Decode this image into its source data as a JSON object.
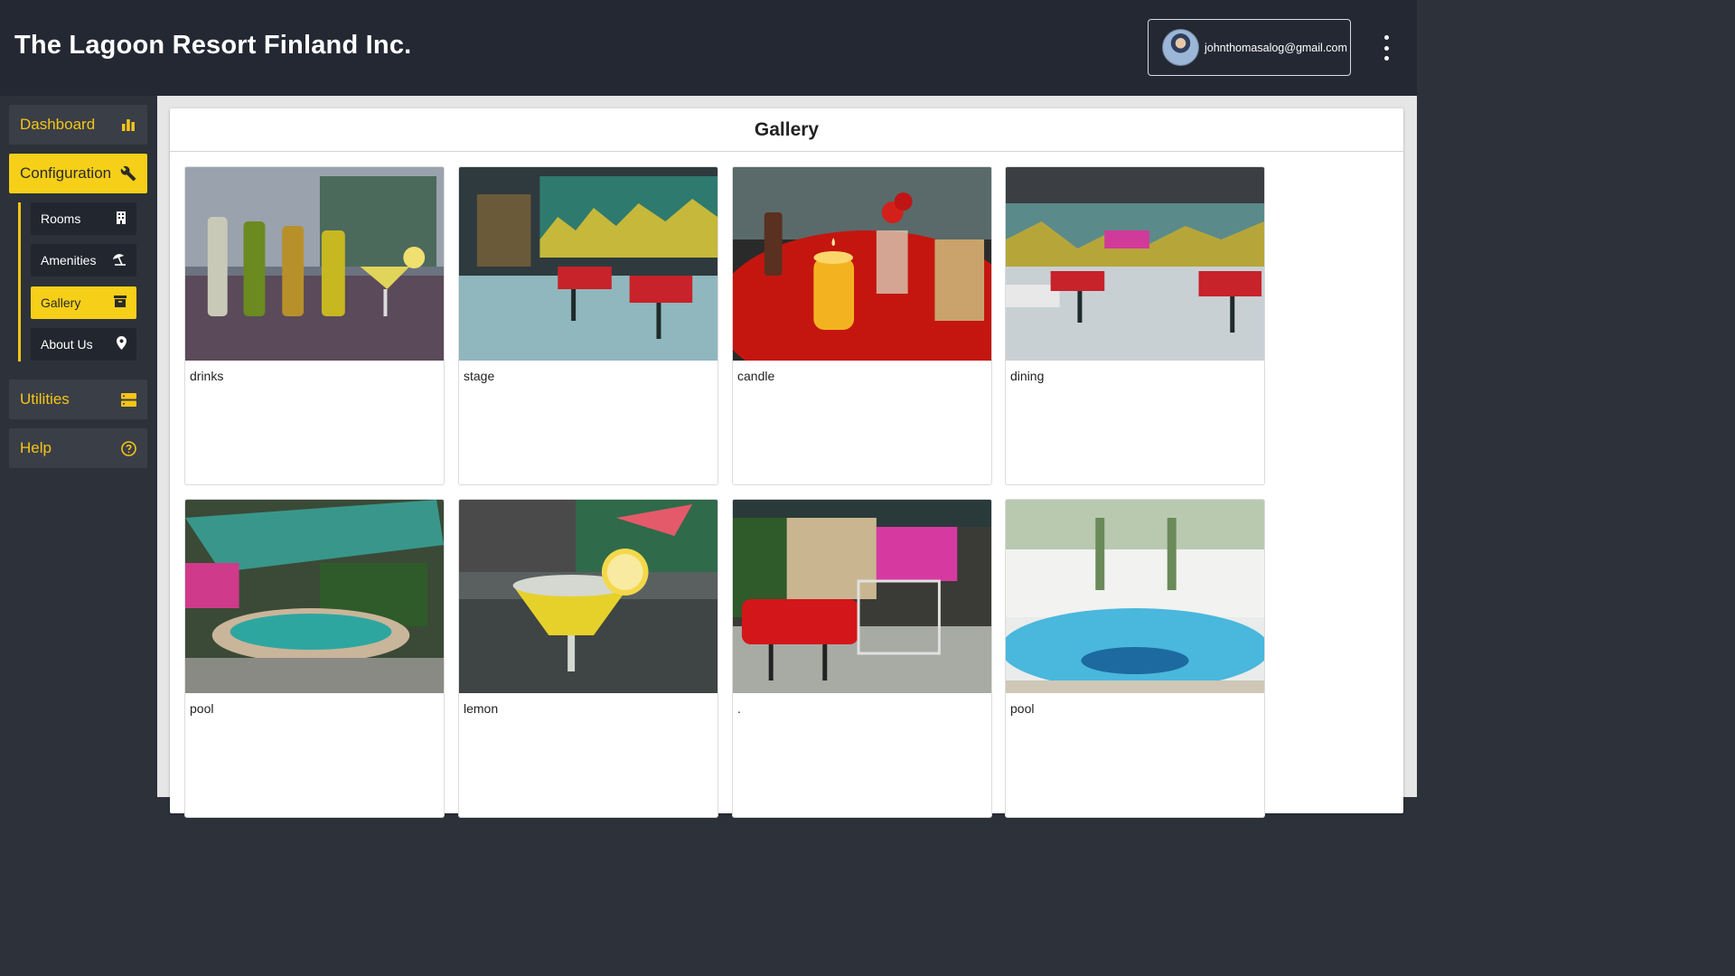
{
  "header": {
    "title": "The Lagoon Resort Finland Inc.",
    "user_email": "johnthomasalog@gmail.com"
  },
  "sidebar": {
    "items": [
      {
        "label": "Dashboard",
        "icon": "bar-chart-icon"
      },
      {
        "label": "Configuration",
        "icon": "wrench-icon",
        "active": true
      },
      {
        "label": "Utilities",
        "icon": "storage-icon"
      },
      {
        "label": "Help",
        "icon": "help-circle-icon"
      }
    ],
    "sub_items": [
      {
        "label": "Rooms",
        "icon": "building-icon"
      },
      {
        "label": "Amenities",
        "icon": "beach-umbrella-icon"
      },
      {
        "label": "Gallery",
        "icon": "archive-icon",
        "active": true
      },
      {
        "label": "About Us",
        "icon": "location-pin-icon"
      }
    ]
  },
  "main": {
    "title": "Gallery",
    "cards": [
      {
        "caption": "drinks"
      },
      {
        "caption": "stage"
      },
      {
        "caption": "candle"
      },
      {
        "caption": "dining"
      },
      {
        "caption": "pool"
      },
      {
        "caption": "lemon"
      },
      {
        "caption": "."
      },
      {
        "caption": "pool"
      }
    ]
  },
  "colors": {
    "accent": "#f5cf18",
    "header_bg": "#232833",
    "sidebar_bg": "#2d313a",
    "nav_bg": "#3a3e47",
    "sub_nav_bg": "#22262e"
  }
}
